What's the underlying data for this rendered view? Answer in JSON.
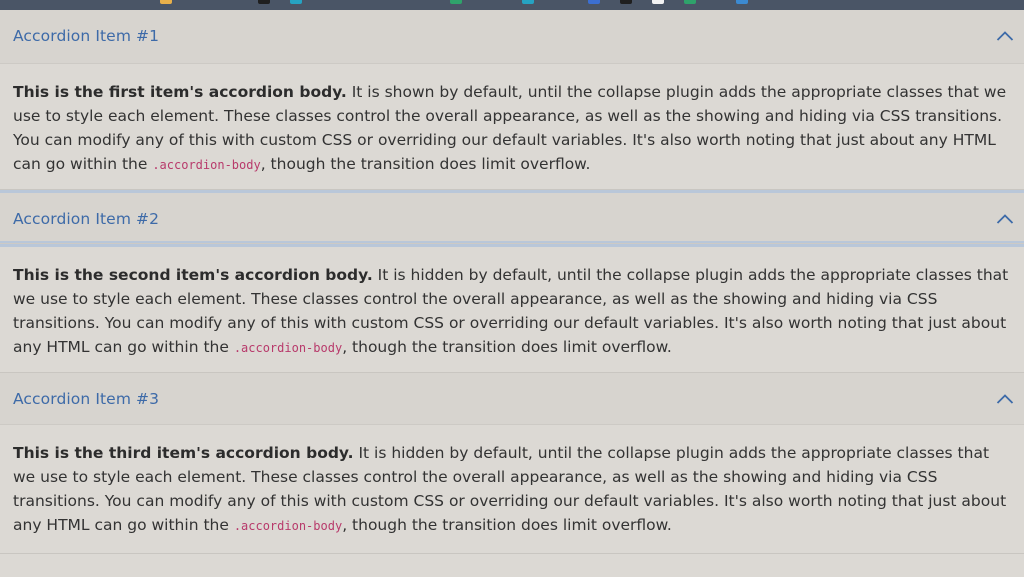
{
  "colors": {
    "accent": "#3d6aa8",
    "code": "#b83a6b",
    "header_bg": "#d7d4cf",
    "body_bg": "#dcd9d4",
    "focus_ring": "#b9c7d9",
    "topbar": "#4a5566"
  },
  "accordion": {
    "items": [
      {
        "title": "Accordion Item #1",
        "expanded": true,
        "icon": "chevron-up-icon",
        "body_strong": "This is the first item's accordion body.",
        "body_text": " It is shown by default, until the collapse plugin adds the appropriate classes that we use to style each element. These classes control the overall appearance, as well as the showing and hiding via CSS transitions. You can modify any of this with custom CSS or overriding our default variables. It's also worth noting that just about any HTML can go within the ",
        "body_code": ".accordion-body",
        "body_tail": ", though the transition does limit overflow."
      },
      {
        "title": "Accordion Item #2",
        "expanded": true,
        "icon": "chevron-up-icon",
        "body_strong": "This is the second item's accordion body.",
        "body_text": " It is hidden by default, until the collapse plugin adds the appropriate classes that we use to style each element. These classes control the overall appearance, as well as the showing and hiding via CSS transitions. You can modify any of this with custom CSS or overriding our default variables. It's also worth noting that just about any HTML can go within the ",
        "body_code": ".accordion-body",
        "body_tail": ", though the transition does limit overflow."
      },
      {
        "title": "Accordion Item #3",
        "expanded": true,
        "icon": "chevron-up-icon",
        "body_strong": "This is the third item's accordion body.",
        "body_text": " It is hidden by default, until the collapse plugin adds the appropriate classes that we use to style each element. These classes control the overall appearance, as well as the showing and hiding via CSS transitions. You can modify any of this with custom CSS or overriding our default variables. It's also worth noting that just about any HTML can go within the ",
        "body_code": ".accordion-body",
        "body_tail": ", though the transition does limit overflow."
      }
    ]
  }
}
